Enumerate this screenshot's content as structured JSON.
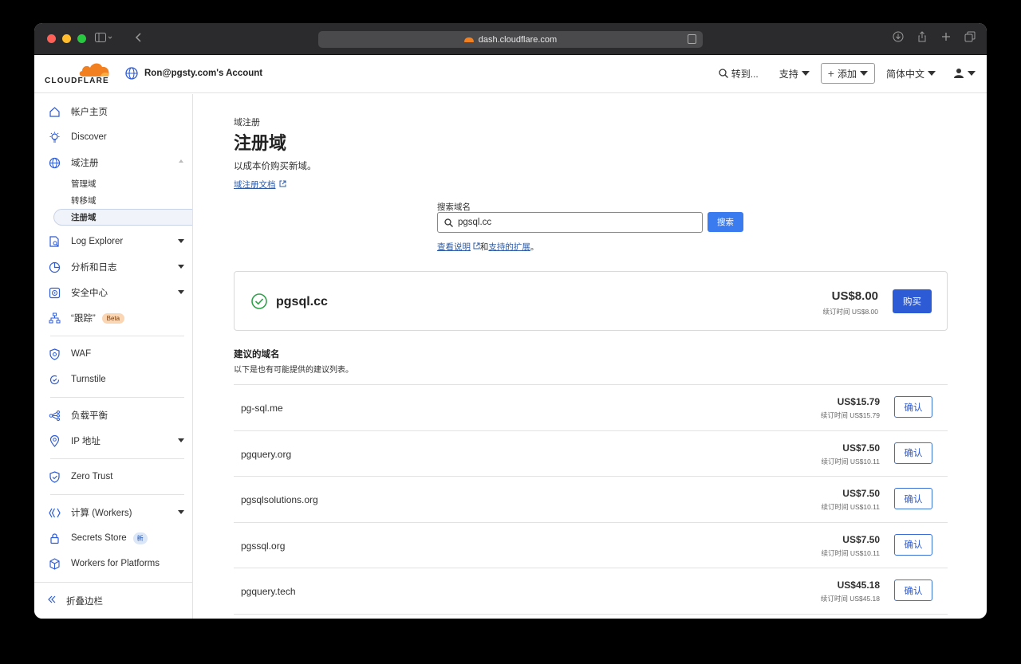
{
  "browser": {
    "url": "dash.cloudflare.com"
  },
  "header": {
    "logo_text": "CLOUDFLARE",
    "account": "Ron@pgsty.com's Account",
    "goto": "转到...",
    "support": "支持",
    "add": "添加",
    "language": "简体中文"
  },
  "sidebar": {
    "items": [
      {
        "label": "帐户主页"
      },
      {
        "label": "Discover"
      },
      {
        "label": "域注册"
      },
      {
        "label": "Log Explorer"
      },
      {
        "label": "分析和日志"
      },
      {
        "label": "安全中心"
      },
      {
        "label": "“跟踪”",
        "badge": "Beta"
      },
      {
        "label": "WAF"
      },
      {
        "label": "Turnstile"
      },
      {
        "label": "负载平衡"
      },
      {
        "label": "IP 地址"
      },
      {
        "label": "Zero Trust"
      },
      {
        "label": "计算 (Workers)"
      },
      {
        "label": "Secrets Store",
        "badge": "新"
      },
      {
        "label": "Workers for Platforms"
      }
    ],
    "sub_items": [
      "管理域",
      "转移域",
      "注册域"
    ],
    "collapse": "折叠边栏"
  },
  "main": {
    "breadcrumb": "域注册",
    "title": "注册域",
    "subtitle": "以成本价购买新域。",
    "doc_link": "域注册文档",
    "search_label": "搜索域名",
    "search_value": "pgsql.cc",
    "search_button": "搜索",
    "help_link1": "查看说明",
    "help_and": "和",
    "help_link2": "支持的扩展",
    "help_end": "。",
    "result": {
      "name": "pgsql.cc",
      "price": "US$8.00",
      "renew": "续订时间 US$8.00",
      "buy": "购买"
    },
    "suggest_title": "建议的域名",
    "suggest_sub": "以下是也有可能提供的建议列表。",
    "confirm_label": "确认",
    "suggestions": [
      {
        "name": "pg-sql.me",
        "price": "US$15.79",
        "renew": "续订时间 US$15.79"
      },
      {
        "name": "pgquery.org",
        "price": "US$7.50",
        "renew": "续订时间 US$10.11"
      },
      {
        "name": "pgsqlsolutions.org",
        "price": "US$7.50",
        "renew": "续订时间 US$10.11"
      },
      {
        "name": "pgssql.org",
        "price": "US$7.50",
        "renew": "续订时间 US$10.11"
      },
      {
        "name": "pgquery.tech",
        "price": "US$45.18",
        "renew": "续订时间 US$45.18"
      }
    ]
  },
  "colors": {
    "brand_orange": "#f38020",
    "primary_blue": "#2c5bd5",
    "link_blue": "#2c5ba8",
    "success_green": "#2fa24a"
  }
}
